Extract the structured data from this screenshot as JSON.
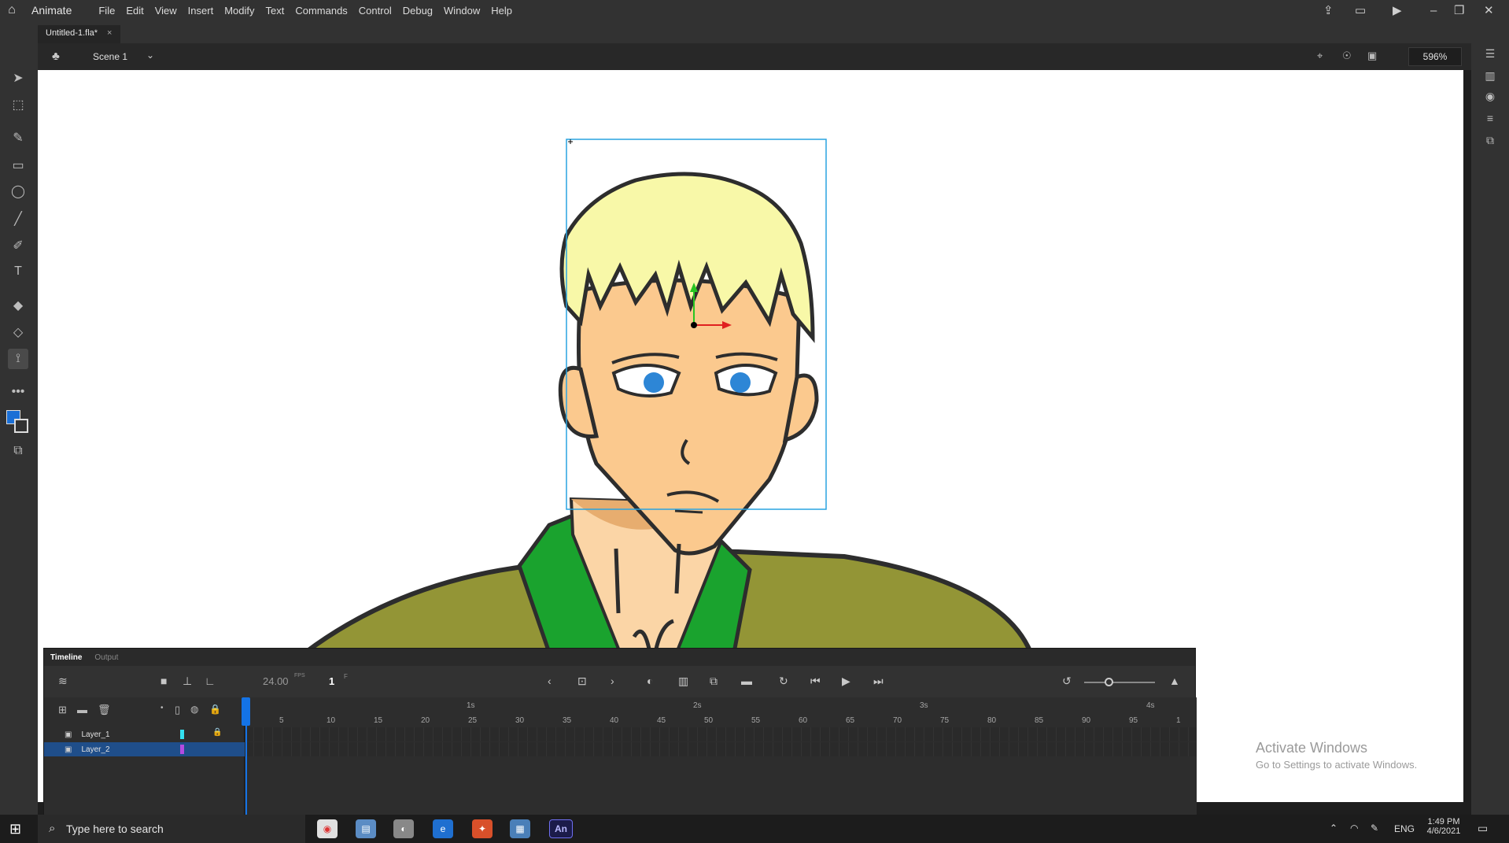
{
  "app": {
    "name": "Animate"
  },
  "menu": [
    "File",
    "Edit",
    "View",
    "Insert",
    "Modify",
    "Text",
    "Commands",
    "Control",
    "Debug",
    "Window",
    "Help"
  ],
  "doc": {
    "tab": "Untitled-1.fla*",
    "scene": "Scene 1",
    "zoom": "596%"
  },
  "timeline": {
    "tabs": [
      "Timeline",
      "Output"
    ],
    "fps": "24.00",
    "fps_unit": "FPS",
    "frame": "1",
    "frame_unit": "F",
    "frame_ticks": [
      "5",
      "10",
      "15",
      "20",
      "25",
      "30",
      "35",
      "40",
      "45",
      "50",
      "55",
      "60",
      "65",
      "70",
      "75",
      "80",
      "85",
      "90",
      "95",
      "1"
    ],
    "second_ticks": [
      "1s",
      "2s",
      "3s",
      "4s"
    ],
    "layers": [
      {
        "name": "Layer_1",
        "color": "#33e0f0",
        "locked": true,
        "selected": false
      },
      {
        "name": "Layer_2",
        "color": "#b44be0",
        "locked": false,
        "selected": true
      }
    ]
  },
  "watermark": {
    "line1": "Activate Windows",
    "line2": "Go to Settings to activate Windows."
  },
  "taskbar": {
    "search_placeholder": "Type here to search",
    "lang": "ENG",
    "time": "1:49 PM",
    "date": "4/6/2021"
  },
  "colors": {
    "accent": "#1473e6",
    "stroke_swatch": "#1a6fd6",
    "hair": "#f8f8a8",
    "skin": "#fbc98e",
    "shirt": "#939536",
    "collar": "#1aa32e"
  }
}
